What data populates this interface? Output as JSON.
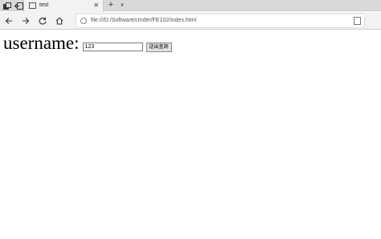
{
  "browser": {
    "tab": {
      "title": "test",
      "close_glyph": "✕"
    },
    "new_tab_glyph": "+",
    "tab_list_glyph": "∨",
    "nav": {
      "back_icon": "arrow-left-icon",
      "forward_icon": "arrow-right-icon",
      "refresh_icon": "refresh-icon",
      "home_icon": "home-icon"
    },
    "address": {
      "url": "file:///D:/Software/cmder/FE102/index.html"
    }
  },
  "page": {
    "label": "username:",
    "input": {
      "value": "123"
    },
    "button": {
      "label": "送出查詢"
    }
  }
}
